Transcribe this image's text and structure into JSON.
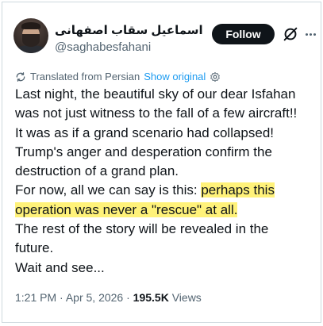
{
  "author": {
    "name": "اسماعیل سقاب اصفهانی",
    "handle": "@saghabesfahani"
  },
  "actions": {
    "follow_label": "Follow",
    "grok_icon": "grok-icon",
    "more_icon": "more-icon"
  },
  "translation": {
    "label": "Translated from Persian",
    "link": "Show original"
  },
  "tweet": {
    "line1": "Last night, the beautiful sky of our dear Isfahan",
    "line2": "was not just witness to the fall of a few aircraft!!",
    "line3": "It was as if a grand scenario had collapsed!",
    "line4": "Trump's anger and desperation confirm the",
    "line5": "destruction of a grand plan.",
    "line6_plain": "For now, all we can say is this: ",
    "line6_highlight": "perhaps this",
    "line7_highlight": "operation was never a \"rescue\" at all.",
    "line8": "The rest of the story will be revealed in the",
    "line9": "future.",
    "line10": "Wait and see...",
    "highlight_color": "#fff27a"
  },
  "meta": {
    "time": "1:21 PM",
    "date": "Apr 5, 2026",
    "views_count": "195.5K",
    "views_label": "Views",
    "separator": "·"
  }
}
